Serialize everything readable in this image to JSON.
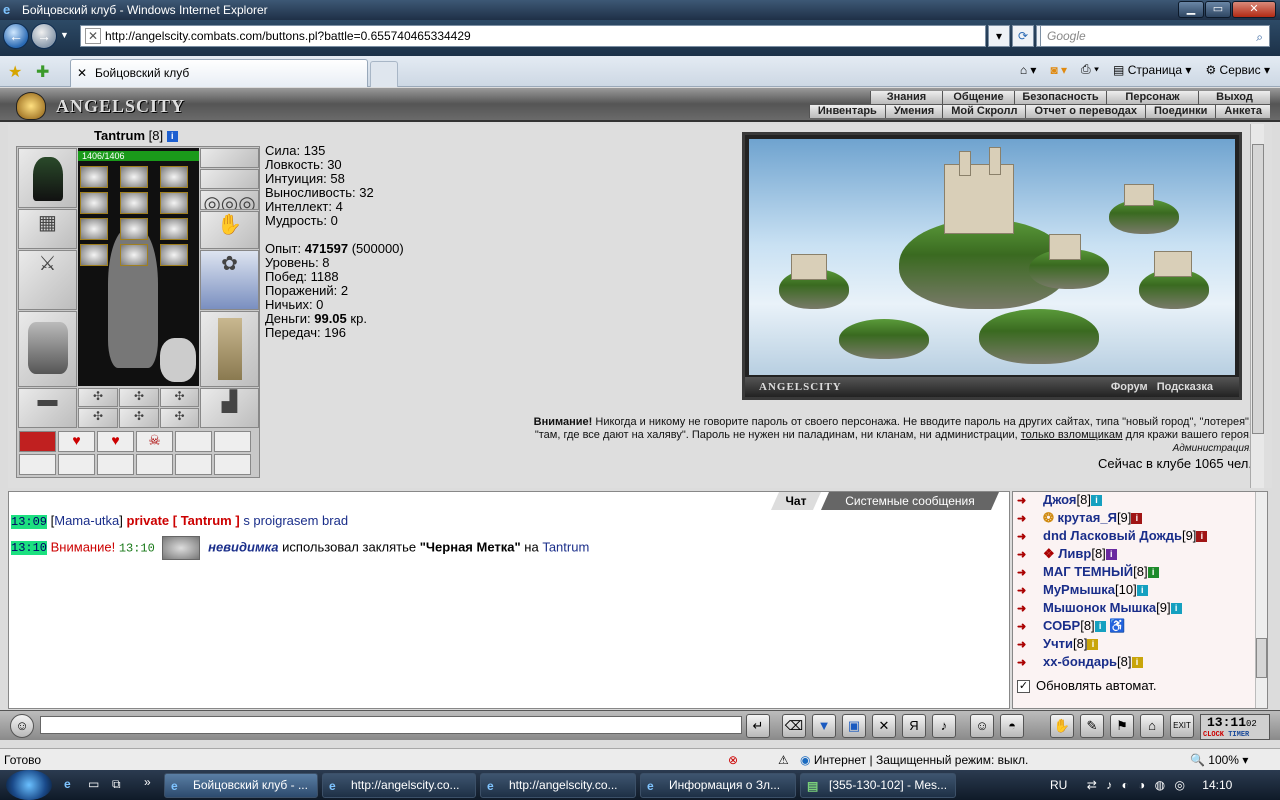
{
  "window": {
    "title": "Бойцовский клуб - Windows Internet Explorer",
    "url": "http://angelscity.combats.com/buttons.pl?battle=0.655740465334429",
    "search_placeholder": "Google",
    "tab_title": "Бойцовский клуб",
    "cmd_page": "Страница",
    "cmd_service": "Сервис"
  },
  "game": {
    "logo": "ANGELSCITY",
    "menu_top": [
      "Знания",
      "Общение",
      "Безопасность",
      "Персонаж",
      "Выход"
    ],
    "menu_bottom": [
      "Инвентарь",
      "Умения",
      "Мой Скролл",
      "Отчет о переводах",
      "Поединки",
      "Анкета"
    ]
  },
  "character": {
    "name": "Tantrum",
    "level": "[8]",
    "hp": "1406/1406",
    "stats": [
      {
        "label": "Сила:",
        "value": "135"
      },
      {
        "label": "Ловкость:",
        "value": "30"
      },
      {
        "label": "Интуиция:",
        "value": "58"
      },
      {
        "label": "Выносливость:",
        "value": "32"
      },
      {
        "label": "Интеллект:",
        "value": "4"
      },
      {
        "label": "Мудрость:",
        "value": "0"
      }
    ],
    "exp_label": "Опыт:",
    "exp_value": "471597",
    "exp_next": "(500000)",
    "level_label": "Уровень: 8",
    "wins": "Побед: 1188",
    "losses": "Поражений: 2",
    "draws": "Ничьих: 0",
    "money_label": "Деньги:",
    "money_value": "99.05",
    "money_unit": "кр.",
    "transfers": "Передач: 196"
  },
  "picture": {
    "caption": "ANGELSCITY",
    "links": "Форум Подсказка"
  },
  "warning": {
    "bold": "Внимание!",
    "text1": "Никогда и никому не говорите пароль от своего персонажа. Не вводите пароль на других сайтах, типа \"новый город\", \"лотерея\",",
    "text2a": "\"там, где все дают на халяву\". Пароль не нужен ни паладинам, ни кланам, ни администрации,",
    "text2u": "только взломщикам",
    "text2b": "для кражи вашего героя.",
    "admin": "Администрация.",
    "online": "Сейчас в клубе 1065 чел."
  },
  "chat": {
    "tab_chat": "Чат",
    "tab_system": "Системные сообщения",
    "line1": {
      "time": "13:09",
      "nick": "Mama-utka",
      "priv": "private [ Tantrum ]",
      "text": "s proigrasem brad"
    },
    "line2": {
      "time": "13:10",
      "warn": "Внимание!",
      "time2": "13:10",
      "who": "невидимка",
      "text1": "использовал заклятье",
      "spell": "\"Черная Метка\"",
      "text2": "на",
      "target": "Tantrum"
    }
  },
  "online_list": [
    {
      "name": "Джоя",
      "lvl": "[8]",
      "badge": "cy"
    },
    {
      "name": "крутая_Я",
      "lvl": "[9]",
      "badge": "red"
    },
    {
      "name": "dnd Ласковый Дождь",
      "lvl": "[9]",
      "badge": "red"
    },
    {
      "name": "Ливр",
      "lvl": "[8]",
      "badge": "pur"
    },
    {
      "name": "МАГ ТЕМНЫЙ",
      "lvl": "[8]",
      "badge": "grn"
    },
    {
      "name": "МуРмышка",
      "lvl": "[10]",
      "badge": "cy"
    },
    {
      "name": "Мышонок Мышка",
      "lvl": "[9]",
      "badge": "cy"
    },
    {
      "name": "СОБР",
      "lvl": "[8]",
      "badge": "cy"
    },
    {
      "name": "Учти",
      "lvl": "[8]",
      "badge": "yel"
    },
    {
      "name": "хх-бондарь",
      "lvl": "[8]",
      "badge": "yel"
    }
  ],
  "auto_refresh": "Обновлять автомат.",
  "clock": {
    "time": "13:11",
    "sec": "02",
    "l1": "CLOCK",
    "l2": "TIMER"
  },
  "status": {
    "ready": "Готово",
    "zone": "Интернет | Защищенный режим: выкл.",
    "zoom": "100%"
  },
  "taskbar": {
    "items": [
      "Бойцовский клуб - ...",
      "http://angelscity.co...",
      "http://angelscity.co...",
      "Информация о Зл...",
      "[355-130-102] - Mes..."
    ],
    "lang": "RU",
    "time": "14:10"
  }
}
